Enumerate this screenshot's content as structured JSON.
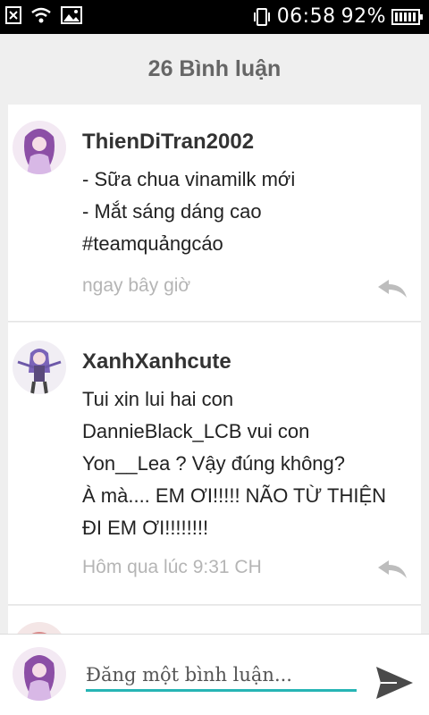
{
  "status_bar": {
    "time": "06:58",
    "battery": "92%",
    "icons": [
      "close-box-icon",
      "wifi-icon",
      "image-icon",
      "vibrate-icon",
      "battery-icon"
    ]
  },
  "header": {
    "title": "26 Bình luận"
  },
  "comments": [
    {
      "author": "ThienDiTran2002",
      "lines": [
        "- Sữa chua vinamilk mới",
        "- Mắt sáng dáng cao",
        "#teamquảngcáo"
      ],
      "time": "ngay bây giờ",
      "reply_icon": "reply-icon"
    },
    {
      "author": "XanhXanhcute",
      "lines": [
        "Tui xin lui hai con",
        "DannieBlack_LCB vui con",
        "Yon__Lea ? Vậy đúng không?",
        "À mà.... EM ƠI!!!!! NÃO TỪ THIỆN",
        "ĐI EM ƠI!!!!!!!!"
      ],
      "time": "Hôm qua lúc 9:31 CH",
      "reply_icon": "reply-icon"
    }
  ],
  "input": {
    "placeholder": "Đăng một bình luận...",
    "value": ""
  },
  "colors": {
    "accent": "#26b5b5",
    "header_bg": "#efefef",
    "muted_text": "#b5b5b5"
  }
}
